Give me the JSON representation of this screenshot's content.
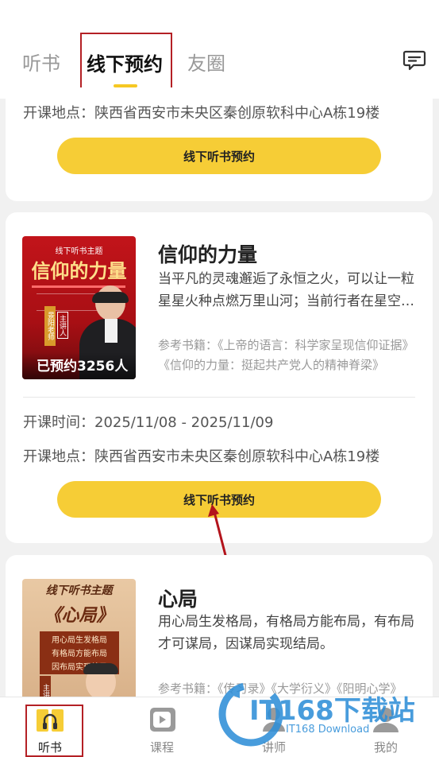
{
  "header": {
    "tabs": [
      "听书",
      "线下预约",
      "友圈"
    ],
    "active_tab": "线下预约"
  },
  "card1": {
    "location": "开课地点：陕西省西安市未央区秦创原软科中心A栋19楼",
    "button_label": "线下听书预约"
  },
  "card2": {
    "cover_topic": "线下听书主题",
    "cover_title": "信仰的力量",
    "cover_teacher": "景阳老师",
    "cover_role": "主讲人",
    "booked_count": "已预约3256人",
    "title": "信仰的力量",
    "description": "当平凡的灵魂邂逅了永恒之火，可以让一粒星星火种点燃万里山河；当前行者在星空之下，书写了信仰的力量。",
    "reference": "参考书籍：《上帝的语言：科学家呈现信仰证据》《信仰的力量：挺起共产党人的精神脊梁》",
    "time": "开课时间：2025/11/08 - 2025/11/09",
    "location": "开课地点：陕西省西安市未央区秦创原软科中心A栋19楼",
    "button_label": "线下听书预约"
  },
  "card3": {
    "cover_topic": "线下听书主题",
    "cover_title": "《心局》",
    "cover_lines": [
      "用心局生发格局",
      "有格局方能布局",
      "因布局实现结局"
    ],
    "cover_role": "主讲",
    "title": "心局",
    "description": "用心局生发格局，有格局方能布局，有布局才可谋局，因谋局实现结局。",
    "reference": "参考书籍：《传习录》《大学衍义》《阳明心学》"
  },
  "bottom_nav": [
    "听书",
    "课程",
    "讲师",
    "我的"
  ],
  "watermark": {
    "brand": "IT168下载站",
    "sub": "IT168 Download"
  },
  "colors": {
    "accent": "#f6cd36",
    "highlight_box": "#b42025"
  }
}
